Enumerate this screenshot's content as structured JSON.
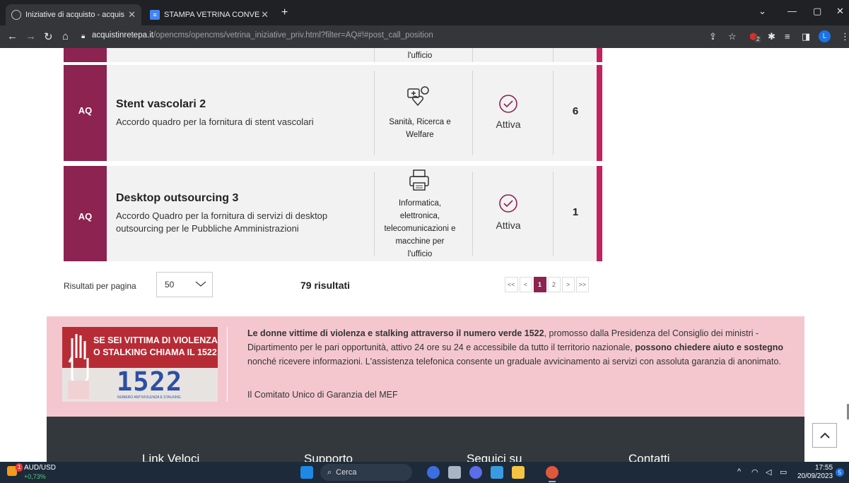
{
  "browser": {
    "tabs": [
      {
        "label": "Iniziative di acquisto - acquistinr"
      },
      {
        "label": "STAMPA VETRINA CONVENZION"
      }
    ],
    "url_host": "acquistinretepa.it",
    "url_path": "/opencms/opencms/vetrina_iniziative_priv.html?filter=AQ#!#post_call_position",
    "profile_initial": "L",
    "ext_badge": "2"
  },
  "rows": [
    {
      "partial_text": "l'ufficio"
    },
    {
      "badge": "AQ",
      "title": "Stent vascolari 2",
      "desc": "Accordo quadro per la fornitura di stent vascolari",
      "category_lines": [
        "Sanità, Ricerca e",
        "Welfare"
      ],
      "status": "Attiva",
      "count": "6"
    },
    {
      "badge": "AQ",
      "title": "Desktop outsourcing 3",
      "desc_lines": [
        "Accordo Quadro per la fornitura di servizi di desktop",
        "outsourcing per le Pubbliche Amministrazioni"
      ],
      "category_lines": [
        "Informatica,",
        "elettronica,",
        "telecomunicazioni e",
        "macchine per",
        "l'ufficio"
      ],
      "status": "Attiva",
      "count": "1"
    }
  ],
  "pagination": {
    "rpp_label": "Risultati per pagina",
    "rpp_value": "50",
    "results": "79 risultati",
    "pages": [
      "<<",
      "<",
      "1",
      "2",
      ">",
      ">>"
    ],
    "current": "1"
  },
  "banner": {
    "poster_line1": "SE SEI VITTIMA DI VIOLENZA",
    "poster_line2": "O STALKING CHIAMA IL 1522",
    "poster_number": "1522",
    "poster_small": "NUMERO ANTIVIOLENZA E STALKING",
    "p1_bold": "Le donne vittime di violenza e stalking attraverso il numero verde 1522",
    "p1_rest": ", promosso dalla Presidenza del Consiglio dei ministri - Dipartimento per le pari opportunità, attivo 24 ore su 24 e accessibile da tutto il territorio nazionale, ",
    "p1_bold2": "possono chiedere aiuto e sostegno",
    "p1_end": " nonché ricevere informazioni. L'assistenza telefonica consente un graduale avvicinamento ai servizi con assoluta garanzia di anonimato.",
    "signature": "Il Comitato Unico di Garanzia del MEF"
  },
  "footer": {
    "headings": [
      "Link Veloci",
      "Supporto",
      "Seguici su",
      "Contatti"
    ]
  },
  "taskbar": {
    "ticker": "AUD/USD",
    "change": "+0,73%",
    "ticker_badge": "1",
    "search": "Cerca",
    "time": "17:55",
    "date": "20/09/2023",
    "notif": "5"
  },
  "colors": {
    "aq_bar": "#8c2351",
    "right_bar": "#c4215f",
    "banner_bg": "#f4c7cf",
    "footer_bg": "#33383d"
  }
}
